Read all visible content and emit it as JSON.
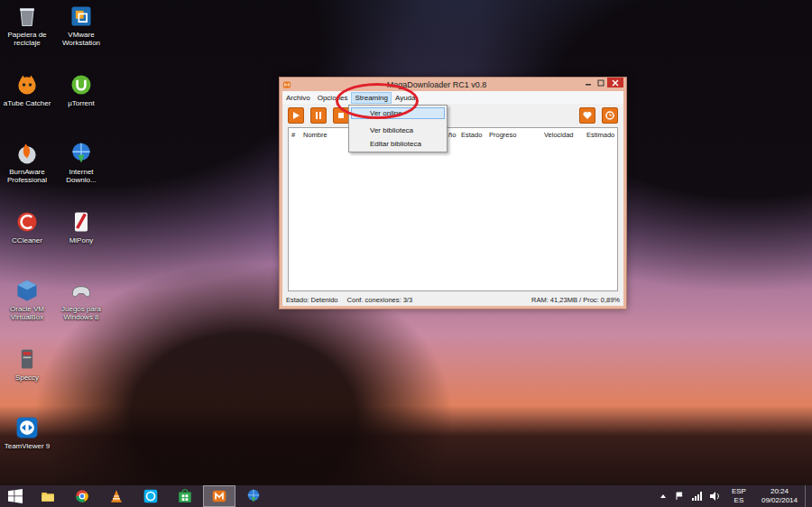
{
  "desktop": {
    "icons": [
      {
        "label": "Papelera de reciclaje",
        "kind": "recycle"
      },
      {
        "label": "aTube Catcher",
        "kind": "atube"
      },
      {
        "label": "BurnAware Professional",
        "kind": "burnaware"
      },
      {
        "label": "CCleaner",
        "kind": "ccleaner"
      },
      {
        "label": "Oracle VM VirtualBox",
        "kind": "virtualbox"
      },
      {
        "label": "Speccy",
        "kind": "speccy"
      },
      {
        "label": "TeamViewer 9",
        "kind": "teamviewer"
      },
      {
        "label": "VMware Workstation",
        "kind": "vmware"
      },
      {
        "label": "µTorrent",
        "kind": "utorrent"
      },
      {
        "label": "Internet Downlo...",
        "kind": "idm"
      },
      {
        "label": "MiPony",
        "kind": "mipony"
      },
      {
        "label": "Juegos para Windows 8",
        "kind": "games"
      }
    ]
  },
  "window": {
    "title": "MegaDownloader RC1 v0.8",
    "menus": [
      {
        "label": "Archivo",
        "selected": false
      },
      {
        "label": "Opciones",
        "selected": false
      },
      {
        "label": "Streaming",
        "selected": true
      },
      {
        "label": "Ayuda",
        "selected": false
      }
    ],
    "open_menu": {
      "items": [
        {
          "label": "Ver online",
          "selected": true
        },
        {
          "label": "Ver biblioteca",
          "selected": false
        },
        {
          "label": "Editar biblioteca",
          "selected": false
        }
      ]
    },
    "table": {
      "columns": [
        "#",
        "Nombre",
        "ño",
        "Estado",
        "Progreso",
        "Velocidad",
        "Estimado"
      ]
    },
    "status_bar": {
      "state": "Estado: Detenido",
      "connections": "Conf. conexiones: 3/3",
      "resources": "RAM: 41,23MB / Proc: 0,89%"
    }
  },
  "taskbar": {
    "items": [
      {
        "kind": "explorer",
        "selected": false
      },
      {
        "kind": "chrome",
        "selected": false
      },
      {
        "kind": "vlc",
        "selected": false
      },
      {
        "kind": "skype",
        "selected": false
      },
      {
        "kind": "store",
        "selected": false
      },
      {
        "kind": "mega",
        "selected": true
      },
      {
        "kind": "idm",
        "selected": false
      }
    ],
    "tray": {
      "language": [
        "ESP",
        "ES"
      ],
      "time": "20:24",
      "date": "09/02/2014"
    }
  }
}
